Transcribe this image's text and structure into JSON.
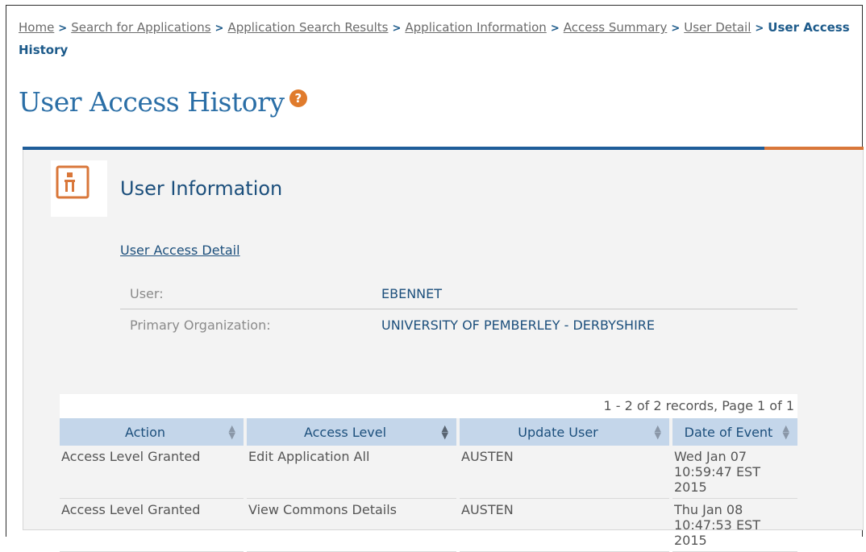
{
  "breadcrumb": {
    "links": [
      "Home",
      "Search for Applications",
      "Application Search Results",
      "Application Information",
      "Access Summary",
      "User Detail"
    ],
    "separator": ">",
    "current": "User Access History"
  },
  "page": {
    "title": "User Access History",
    "help_icon": "?"
  },
  "panel": {
    "title": "User Information",
    "detail_link": "User Access Detail",
    "fields": [
      {
        "label": "User:",
        "value": "EBENNET"
      },
      {
        "label": "Primary Organization:",
        "value": "UNIVERSITY OF PEMBERLEY - DERBYSHIRE"
      }
    ]
  },
  "grid": {
    "records": "1 - 2 of 2 records, Page 1 of 1",
    "columns": [
      "Action",
      "Access Level",
      "Update User",
      "Date of Event"
    ],
    "rows": [
      [
        "Access Level Granted",
        "Edit Application All",
        "AUSTEN",
        "Wed Jan 07 10:59:47 EST 2015"
      ],
      [
        "Access Level Granted",
        "View Commons Details",
        "AUSTEN",
        "Thu Jan 08 10:47:53 EST 2015"
      ]
    ]
  },
  "colors": {
    "accent_blue": "#1f5d99",
    "accent_orange": "#d9773a",
    "header_bg": "#c4d6ea"
  }
}
